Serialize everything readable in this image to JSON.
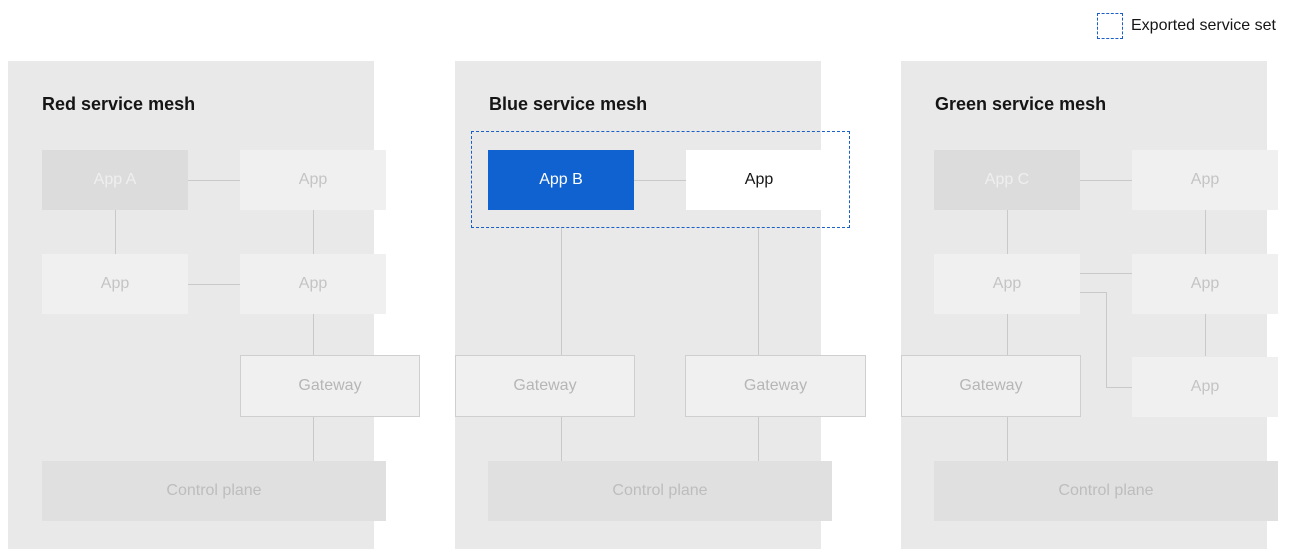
{
  "legend": {
    "icon": "dashed-square-icon",
    "label": "Exported service set"
  },
  "colors": {
    "panel": "#e9e9e9",
    "accent": "#0f62cf",
    "dashed_border": "#1a5fc9"
  },
  "meshes": {
    "red": {
      "title": "Red service mesh",
      "app_main": "App A",
      "app_top_right": "App",
      "app_mid_left": "App",
      "app_mid_right": "App",
      "gateway": "Gateway",
      "control_plane": "Control plane"
    },
    "blue": {
      "title": "Blue service mesh",
      "app_exported_main": "App B",
      "app_exported_other": "App",
      "gateway_left": "Gateway",
      "gateway_right": "Gateway",
      "control_plane": "Control plane"
    },
    "green": {
      "title": "Green service mesh",
      "app_main": "App C",
      "app_top_right": "App",
      "app_mid_left": "App",
      "app_mid_right": "App",
      "gateway": "Gateway",
      "app_bottom_right": "App",
      "control_plane": "Control plane"
    }
  }
}
